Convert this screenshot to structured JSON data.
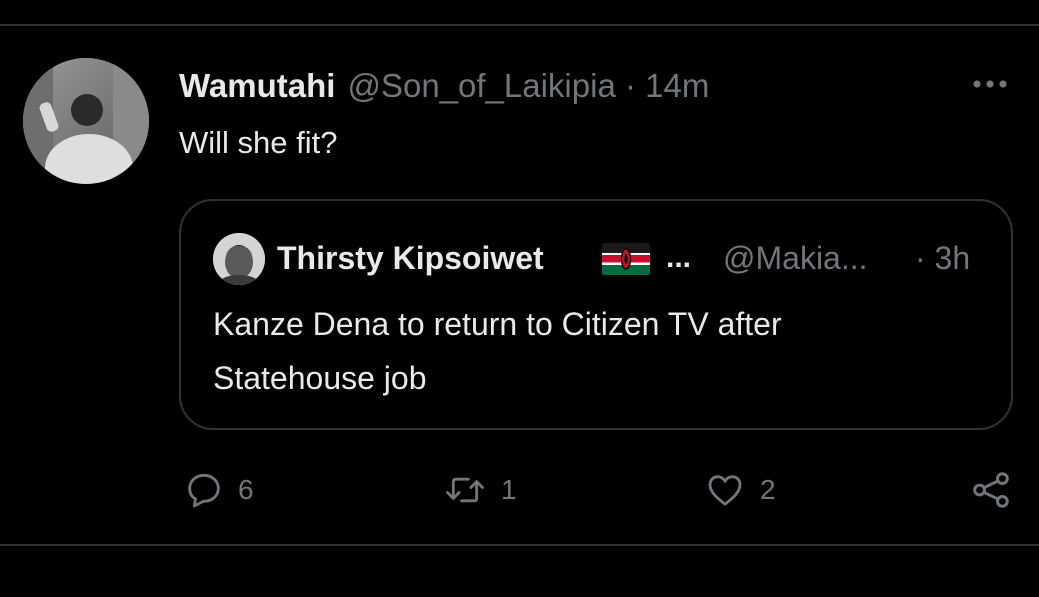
{
  "tweet": {
    "author_name": "Wamutahi",
    "meta": "@Son_of_Laikipia · 14m",
    "text": "Will she fit?",
    "more_icon": "more-horizontal-icon"
  },
  "quoted_tweet": {
    "author_name": "Thirsty Kipsoiwet",
    "flag_icon": "kenya-flag-icon",
    "ellipsis": "...",
    "handle": "@Makia...",
    "time": "· 3h",
    "text_line1": "Kanze Dena to return to Citizen TV after",
    "text_line2": "Statehouse job"
  },
  "actions": {
    "reply_count": "6",
    "retweet_count": "1",
    "like_count": "2"
  },
  "colors": {
    "background": "#000000",
    "text": "#e7e9ea",
    "secondary": "#71767b",
    "border": "#2f3336"
  }
}
